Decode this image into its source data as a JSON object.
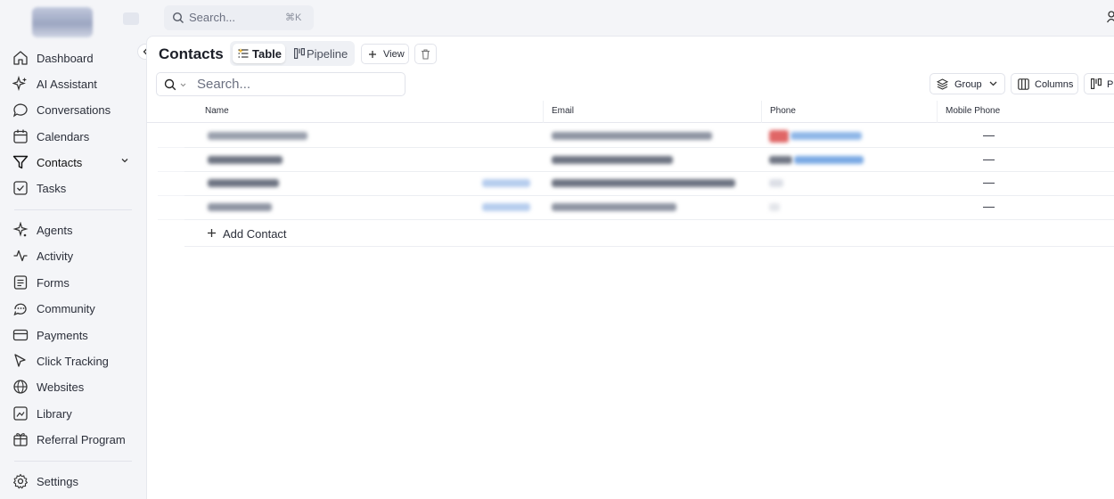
{
  "topbar": {
    "search_placeholder": "Search...",
    "shortcut": "⌘K"
  },
  "sidebar": {
    "items": [
      {
        "label": "Dashboard",
        "icon": "home-icon"
      },
      {
        "label": "AI Assistant",
        "icon": "sparkle-icon"
      },
      {
        "label": "Conversations",
        "icon": "chat-icon"
      },
      {
        "label": "Calendars",
        "icon": "calendar-icon"
      },
      {
        "label": "Contacts",
        "icon": "filter-icon",
        "active": true
      },
      {
        "label": "Tasks",
        "icon": "checkbox-icon"
      },
      {
        "label": "Agents",
        "icon": "agent-icon"
      },
      {
        "label": "Activity",
        "icon": "activity-icon"
      },
      {
        "label": "Forms",
        "icon": "form-icon"
      },
      {
        "label": "Community",
        "icon": "community-icon"
      },
      {
        "label": "Payments",
        "icon": "card-icon"
      },
      {
        "label": "Click Tracking",
        "icon": "cursor-icon"
      },
      {
        "label": "Websites",
        "icon": "globe-icon"
      },
      {
        "label": "Library",
        "icon": "library-icon"
      },
      {
        "label": "Referral Program",
        "icon": "referral-icon"
      },
      {
        "label": "Settings",
        "icon": "gear-icon"
      }
    ]
  },
  "main": {
    "title": "Contacts",
    "tabs": [
      {
        "label": "Table"
      },
      {
        "label": "Pipeline"
      }
    ],
    "view_label": "View",
    "search_placeholder": "Search...",
    "toolbar": {
      "group_label": "Group",
      "columns_label": "Columns",
      "pin_label": "Pi"
    },
    "table": {
      "columns": [
        "Name",
        "Email",
        "Phone",
        "Mobile Phone"
      ],
      "rows": [
        {
          "mobile_phone": "—"
        },
        {
          "mobile_phone": "—"
        },
        {
          "mobile_phone": "—"
        },
        {
          "mobile_phone": "—"
        }
      ],
      "add_label": "Add Contact"
    }
  }
}
